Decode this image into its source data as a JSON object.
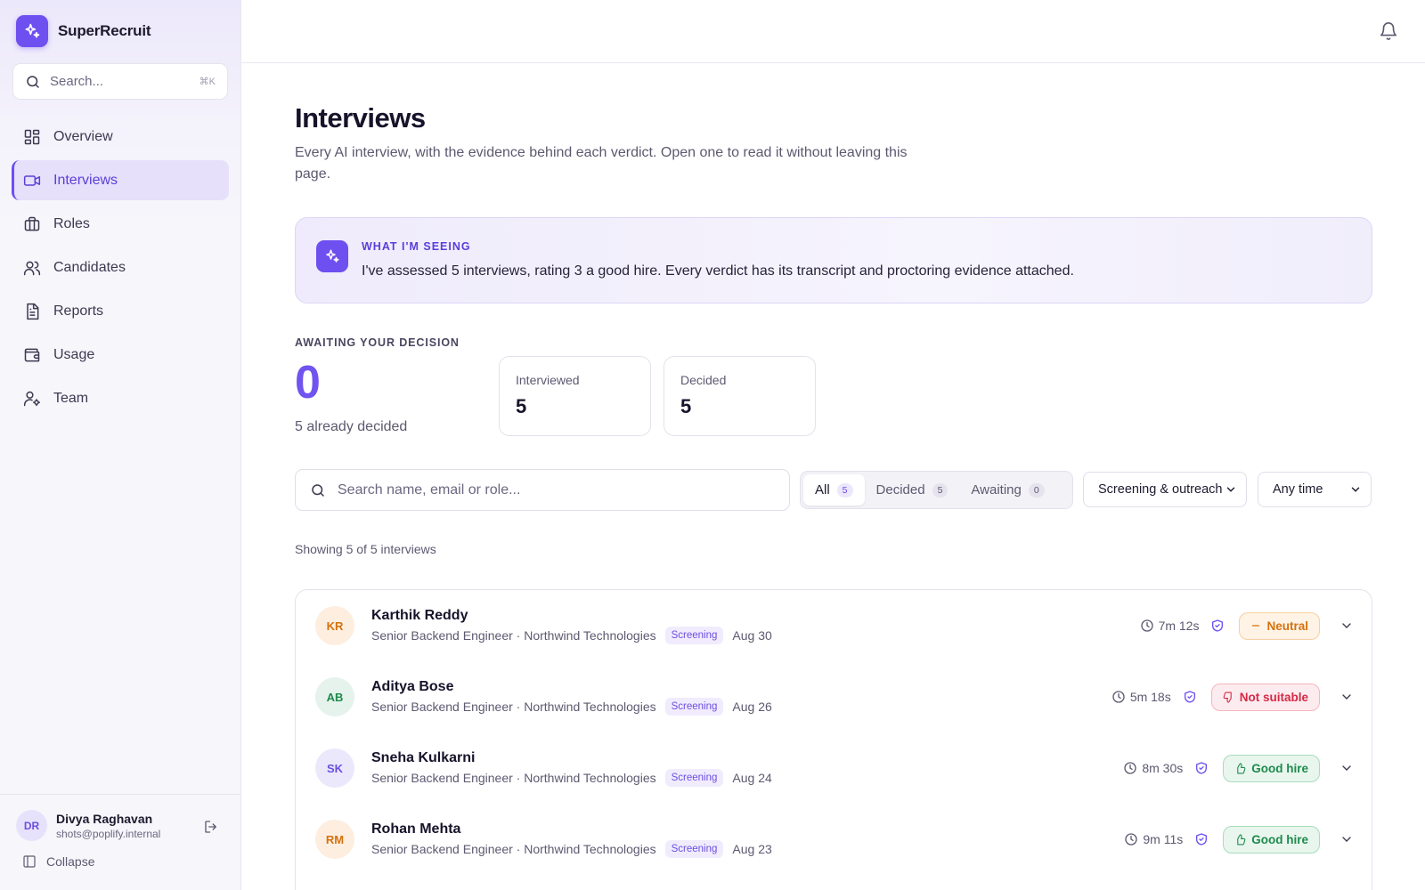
{
  "brand": {
    "name": "SuperRecruit"
  },
  "sidebar": {
    "search_placeholder": "Search...",
    "search_shortcut": "⌘K",
    "items": [
      {
        "label": "Overview",
        "icon": "grid-icon"
      },
      {
        "label": "Interviews",
        "icon": "video-icon",
        "active": true
      },
      {
        "label": "Roles",
        "icon": "briefcase-icon"
      },
      {
        "label": "Candidates",
        "icon": "users-icon"
      },
      {
        "label": "Reports",
        "icon": "document-icon"
      },
      {
        "label": "Usage",
        "icon": "wallet-icon"
      },
      {
        "label": "Team",
        "icon": "user-settings-icon"
      }
    ],
    "user": {
      "initials": "DR",
      "name": "Divya Raghavan",
      "email": "shots@poplify.internal"
    },
    "collapse_label": "Collapse"
  },
  "header": {
    "title": "Interviews",
    "subtitle": "Every AI interview, with the evidence behind each verdict. Open one to read it without leaving this page."
  },
  "insight": {
    "label": "WHAT I'M SEEING",
    "text": "I've assessed 5 interviews, rating 3 a good hire. Every verdict has its transcript and proctoring evidence attached."
  },
  "summary": {
    "awaiting_label": "AWAITING YOUR DECISION",
    "awaiting_count": "0",
    "awaiting_sub": "5 already decided",
    "stats": [
      {
        "label": "Interviewed",
        "value": "5"
      },
      {
        "label": "Decided",
        "value": "5"
      }
    ]
  },
  "filters": {
    "search_placeholder": "Search name, email or role...",
    "tabs": [
      {
        "label": "All",
        "count": "5",
        "active": true
      },
      {
        "label": "Decided",
        "count": "5"
      },
      {
        "label": "Awaiting",
        "count": "0"
      }
    ],
    "stage_select": "Screening & outreach",
    "time_select": "Any time"
  },
  "showing": "Showing 5 of 5 interviews",
  "rows": [
    {
      "initials": "KR",
      "name": "Karthik Reddy",
      "role": "Senior Backend Engineer · Northwind Technologies",
      "stage": "Screening",
      "date": "Aug 30",
      "duration": "7m 12s",
      "verdict": "Neutral",
      "verdict_type": "neutral"
    },
    {
      "initials": "AB",
      "name": "Aditya Bose",
      "role": "Senior Backend Engineer · Northwind Technologies",
      "stage": "Screening",
      "date": "Aug 26",
      "duration": "5m 18s",
      "verdict": "Not suitable",
      "verdict_type": "bad"
    },
    {
      "initials": "SK",
      "name": "Sneha Kulkarni",
      "role": "Senior Backend Engineer · Northwind Technologies",
      "stage": "Screening",
      "date": "Aug 24",
      "duration": "8m 30s",
      "verdict": "Good hire",
      "verdict_type": "good"
    },
    {
      "initials": "RM",
      "name": "Rohan Mehta",
      "role": "Senior Backend Engineer · Northwind Technologies",
      "stage": "Screening",
      "date": "Aug 23",
      "duration": "9m 11s",
      "verdict": "Good hire",
      "verdict_type": "good"
    }
  ],
  "colors": {
    "accent": "#6e4ff0",
    "avatar_orange_bg": "#fdeee0",
    "avatar_orange_fg": "#d4720e",
    "avatar_green_bg": "#e5f3ec",
    "avatar_green_fg": "#1f8a4c",
    "avatar_purple_bg": "#ece8fb",
    "avatar_purple_fg": "#6b4fe0"
  }
}
